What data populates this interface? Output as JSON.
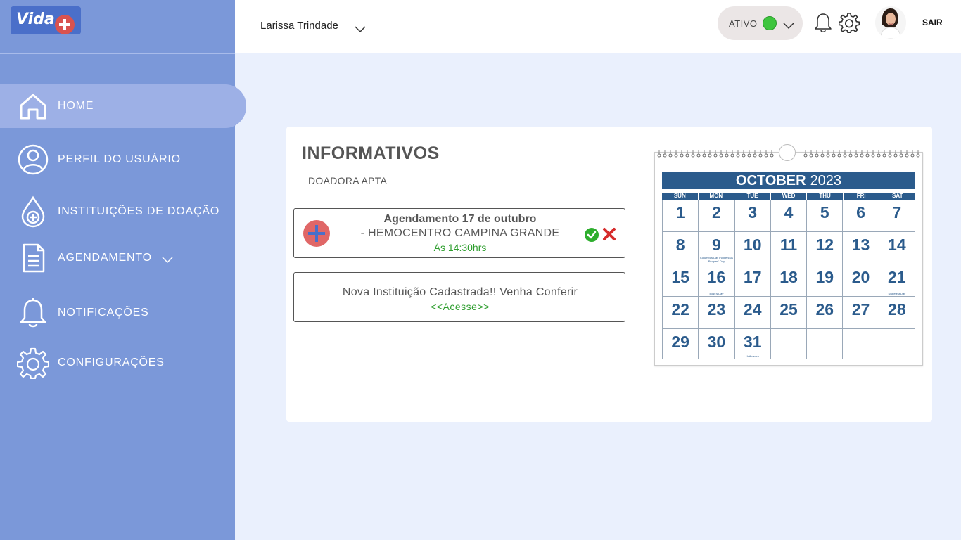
{
  "app": {
    "logo_text": "Vida"
  },
  "sidebar": {
    "items": [
      {
        "label": "HOME",
        "icon": "home-icon"
      },
      {
        "label": "PERFIL DO USUÁRIO",
        "icon": "user-icon"
      },
      {
        "label": "INSTITUIÇÕES DE DOAÇÃO",
        "icon": "blood-drop-icon"
      },
      {
        "label": "AGENDAMENTO",
        "icon": "document-icon"
      },
      {
        "label": "NOTIFICAÇÕES",
        "icon": "bell-icon"
      },
      {
        "label": "CONFIGURAÇÕES",
        "icon": "gear-icon"
      }
    ],
    "active_index": 0
  },
  "header": {
    "user_name": "Larissa Trindade",
    "status_label": "ATIVO",
    "status_color": "#3ec53e",
    "logout_label": "SAIR"
  },
  "main": {
    "title": "INFORMATIVOS",
    "subtitle": "DOADORA APTA",
    "appointment": {
      "title": "Agendamento 17 de outubro",
      "place": "- HEMOCENTRO CAMPINA GRANDE",
      "time": "Às 14:30hrs"
    },
    "news": {
      "text": "Nova Instituição Cadastrada!! Venha Conferir",
      "link": "<<Acesse>>"
    }
  },
  "calendar": {
    "month": "OCTOBER",
    "year": "2023",
    "weekdays": [
      "SUN",
      "MON",
      "TUE",
      "WED",
      "THU",
      "FRI",
      "SAT"
    ],
    "weeks": [
      [
        {
          "d": "1"
        },
        {
          "d": "2"
        },
        {
          "d": "3"
        },
        {
          "d": "4"
        },
        {
          "d": "5"
        },
        {
          "d": "6"
        },
        {
          "d": "7"
        }
      ],
      [
        {
          "d": "8"
        },
        {
          "d": "9",
          "note": "Columbus Day Indigenous Peoples' Day"
        },
        {
          "d": "10"
        },
        {
          "d": "11"
        },
        {
          "d": "12"
        },
        {
          "d": "13"
        },
        {
          "d": "14"
        }
      ],
      [
        {
          "d": "15"
        },
        {
          "d": "16",
          "note": "Boss's Day"
        },
        {
          "d": "17"
        },
        {
          "d": "18"
        },
        {
          "d": "19"
        },
        {
          "d": "20"
        },
        {
          "d": "21",
          "note": "Sweetest Day"
        }
      ],
      [
        {
          "d": "22"
        },
        {
          "d": "23"
        },
        {
          "d": "24"
        },
        {
          "d": "25"
        },
        {
          "d": "26"
        },
        {
          "d": "27"
        },
        {
          "d": "28"
        }
      ],
      [
        {
          "d": "29"
        },
        {
          "d": "30"
        },
        {
          "d": "31",
          "note": "Halloween"
        },
        {
          "d": ""
        },
        {
          "d": ""
        },
        {
          "d": ""
        },
        {
          "d": ""
        }
      ]
    ]
  }
}
